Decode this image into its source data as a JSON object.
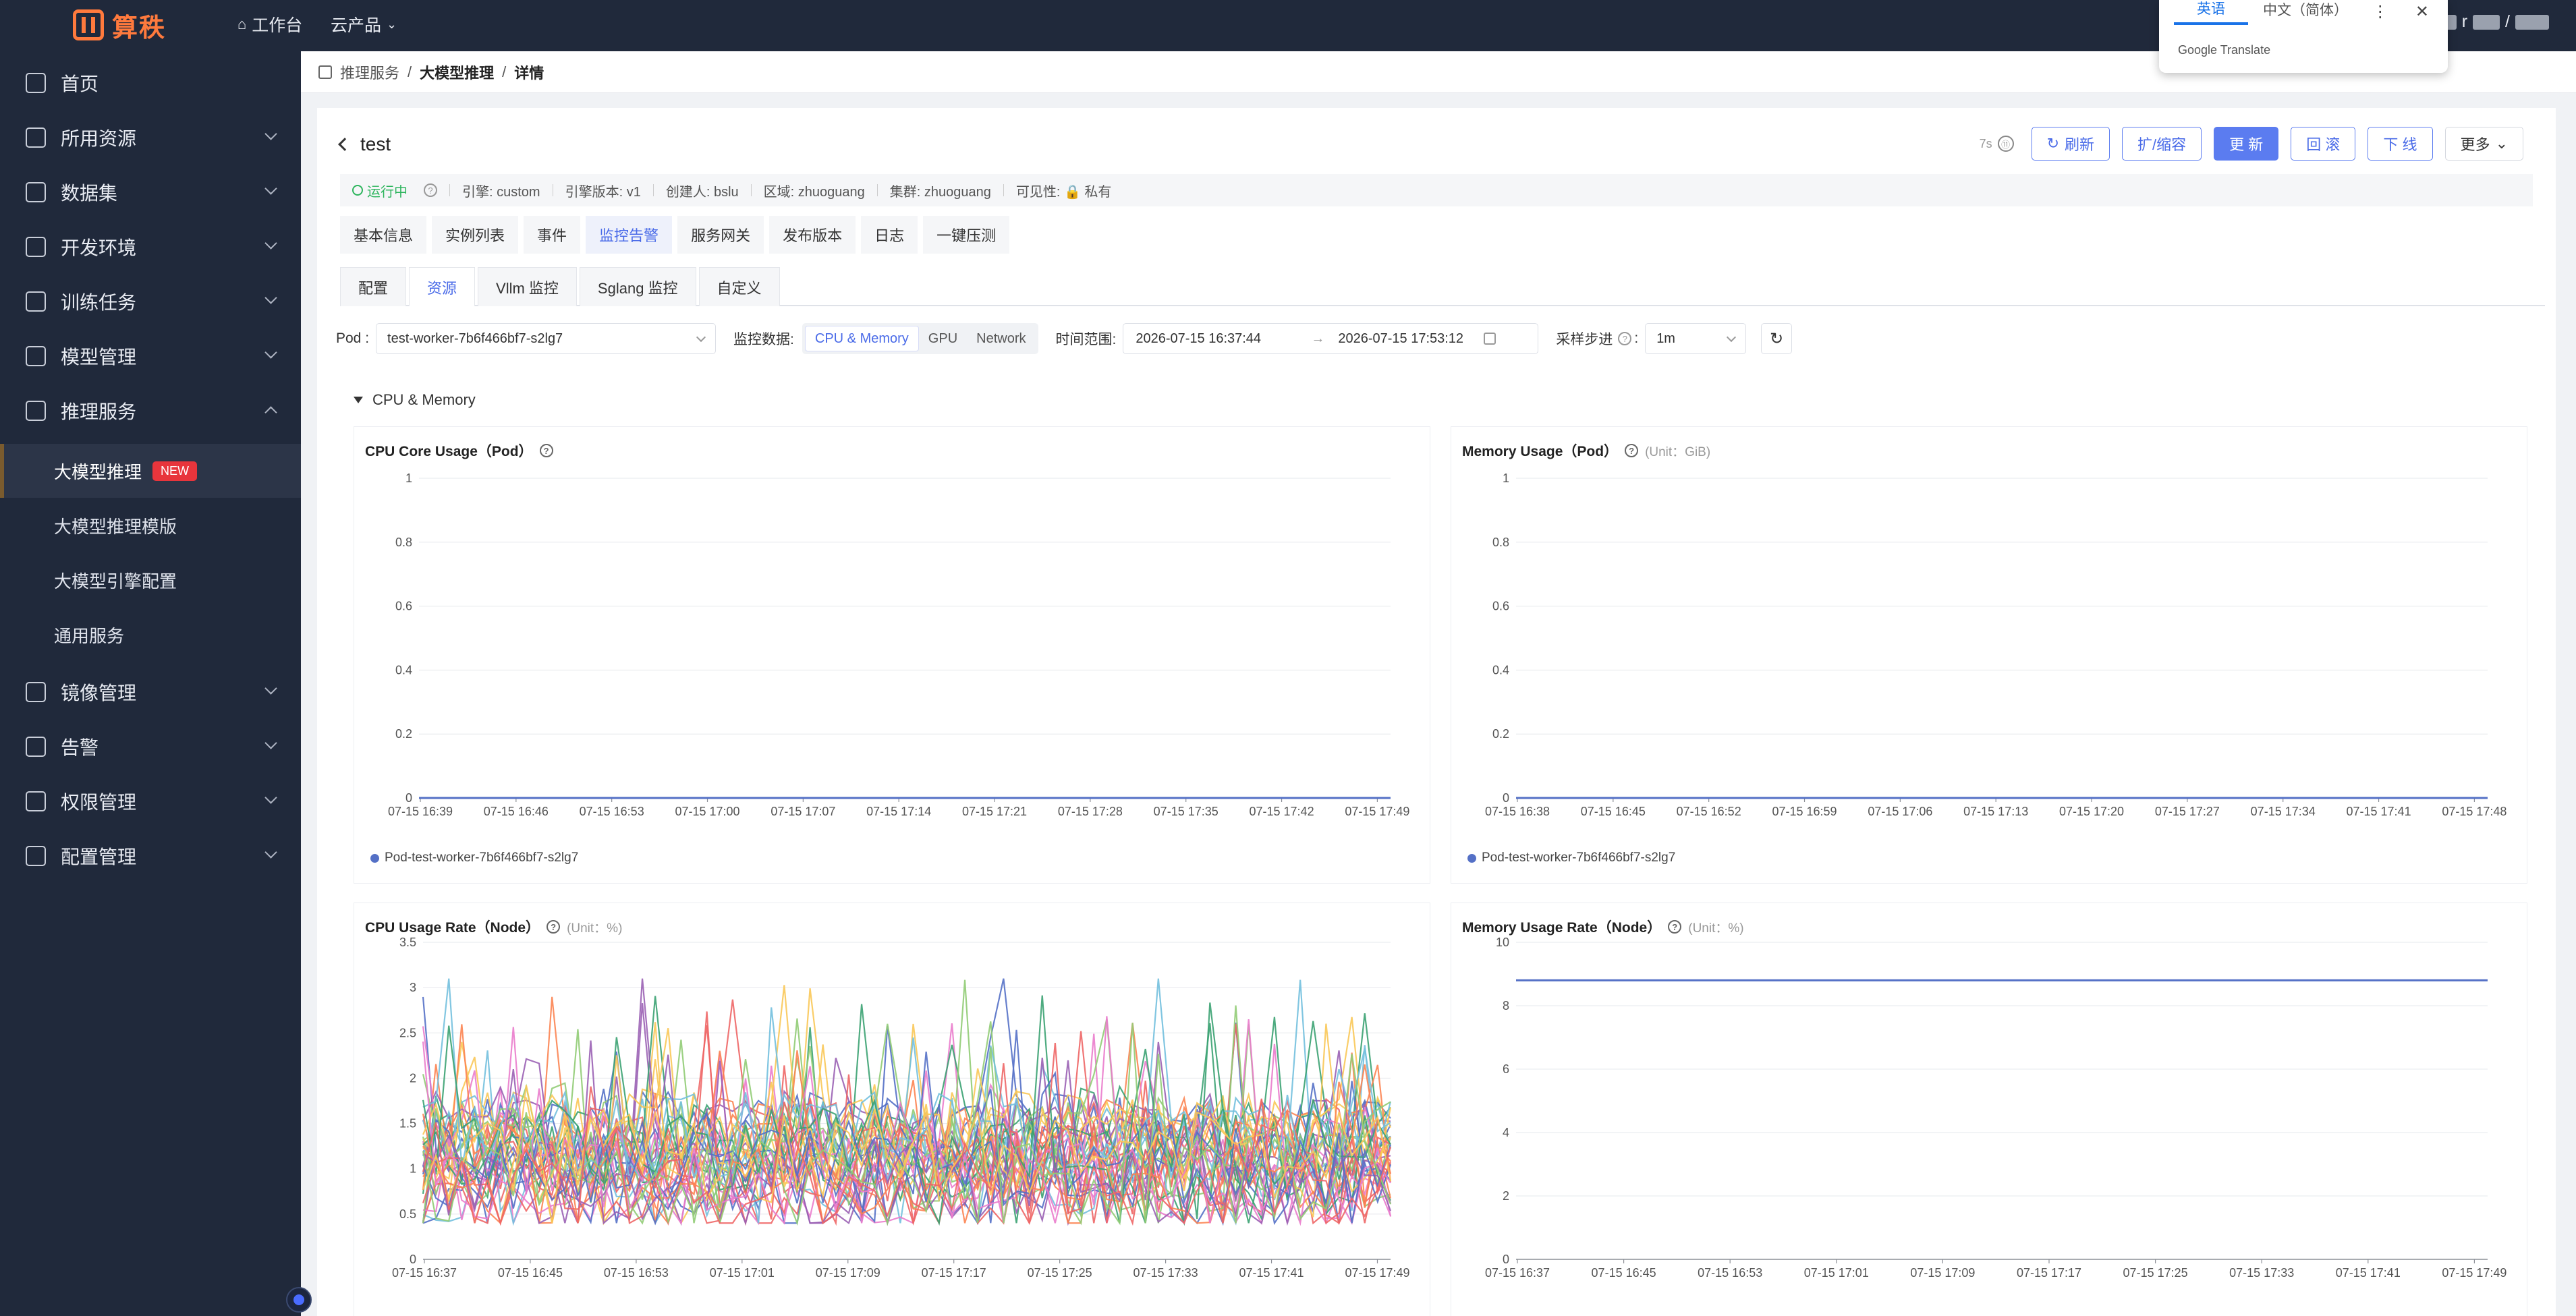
{
  "topbar": {
    "logo_text": "算秩",
    "workbench": "工作台",
    "cloud_products": "云产品",
    "user_sep": "/",
    "user_partial": "r"
  },
  "translate_popup": {
    "tab_en": "英语",
    "tab_zh": "中文（简体）",
    "brand": "Google Translate"
  },
  "sidebar": {
    "items": [
      {
        "label": "首页",
        "icon": "home-icon"
      },
      {
        "label": "所用资源",
        "icon": "resource-icon"
      },
      {
        "label": "数据集",
        "icon": "dataset-icon"
      },
      {
        "label": "开发环境",
        "icon": "dev-env-icon"
      },
      {
        "label": "训练任务",
        "icon": "training-icon"
      },
      {
        "label": "模型管理",
        "icon": "model-icon"
      },
      {
        "label": "推理服务",
        "icon": "inference-icon"
      },
      {
        "label": "镜像管理",
        "icon": "image-icon"
      },
      {
        "label": "告警",
        "icon": "alert-icon"
      },
      {
        "label": "权限管理",
        "icon": "permission-icon"
      },
      {
        "label": "配置管理",
        "icon": "config-icon"
      }
    ],
    "sub_items": [
      {
        "label": "大模型推理",
        "badge": "NEW"
      },
      {
        "label": "大模型推理模版"
      },
      {
        "label": "大模型引擎配置"
      },
      {
        "label": "通用服务"
      }
    ]
  },
  "breadcrumb": {
    "root": "推理服务",
    "mid": "大模型推理",
    "leaf": "详情",
    "sep": "/"
  },
  "page": {
    "title": "test",
    "timer": "7s",
    "timer_icon": "⑪",
    "actions": {
      "refresh": "刷新",
      "scale": "扩/缩容",
      "update": "更 新",
      "rollback": "回 滚",
      "offline": "下 线",
      "more": "更多"
    }
  },
  "meta": {
    "status": "运行中",
    "engine": "引擎: custom",
    "engine_version": "引擎版本: v1",
    "creator": "创建人: bslu",
    "region": "区域: zhuoguang",
    "cluster": "集群: zhuoguang",
    "visibility": "可见性: 🔒 私有"
  },
  "tabs_main": [
    "基本信息",
    "实例列表",
    "事件",
    "监控告警",
    "服务网关",
    "发布版本",
    "日志",
    "一键压测"
  ],
  "tabs_monitor": [
    "配置",
    "资源",
    "Vllm 监控",
    "Sglang 监控",
    "自定义"
  ],
  "filters": {
    "pod_label": "Pod :",
    "pod_value": "test-worker-7b6f466bf7-s2lg7",
    "data_label": "监控数据:",
    "data_options": [
      "CPU & Memory",
      "GPU",
      "Network"
    ],
    "time_label": "时间范围:",
    "time_start": "2026-07-15 16:37:44",
    "time_arrow": "→",
    "time_end": "2026-07-15 17:53:12",
    "step_label": "采样步进",
    "step_help": "?",
    "step_colon": ":",
    "step_value": "1m"
  },
  "section": {
    "title": "CPU & Memory"
  },
  "charts": {
    "cpu_core": {
      "title": "CPU Core Usage（Pod）",
      "unit": "",
      "legend": "Pod-test-worker-7b6f466bf7-s2lg7"
    },
    "mem_usage": {
      "title": "Memory Usage（Pod）",
      "unit": "(Unit：GiB)",
      "legend": "Pod-test-worker-7b6f466bf7-s2lg7"
    },
    "cpu_rate": {
      "title": "CPU Usage Rate（Node）",
      "unit": "(Unit：%)"
    },
    "mem_rate": {
      "title": "Memory Usage Rate（Node）",
      "unit": "(Unit：%)"
    }
  },
  "chart_data": [
    {
      "type": "line",
      "ylim": [
        0,
        1
      ],
      "yticks": [
        "0",
        "0.2",
        "0.4",
        "0.6",
        "0.8",
        "1"
      ],
      "categories": [
        "07-15 16:39",
        "07-15 16:46",
        "07-15 16:53",
        "07-15 17:00",
        "07-15 17:07",
        "07-15 17:14",
        "07-15 17:21",
        "07-15 17:28",
        "07-15 17:35",
        "07-15 17:42",
        "07-15 17:49"
      ],
      "series": [
        {
          "name": "Pod-test-worker-7b6f466bf7-s2lg7",
          "values": [
            0,
            0,
            0,
            0,
            0,
            0,
            0,
            0,
            0,
            0,
            0
          ]
        }
      ],
      "color": "#5470c6"
    },
    {
      "type": "line",
      "ylim": [
        0,
        1
      ],
      "yticks": [
        "0",
        "0.2",
        "0.4",
        "0.6",
        "0.8",
        "1"
      ],
      "categories": [
        "07-15 16:38",
        "07-15 16:45",
        "07-15 16:52",
        "07-15 16:59",
        "07-15 17:06",
        "07-15 17:13",
        "07-15 17:20",
        "07-15 17:27",
        "07-15 17:34",
        "07-15 17:41",
        "07-15 17:48"
      ],
      "series": [
        {
          "name": "Pod-test-worker-7b6f466bf7-s2lg7",
          "values": [
            0,
            0,
            0,
            0,
            0,
            0,
            0,
            0,
            0,
            0,
            0
          ]
        }
      ],
      "color": "#5470c6"
    },
    {
      "type": "line",
      "ylim": [
        0,
        3.5
      ],
      "yticks": [
        "0",
        "0.5",
        "1",
        "1.5",
        "2",
        "2.5",
        "3",
        "3.5"
      ],
      "categories": [
        "07-15 16:37",
        "07-15 16:45",
        "07-15 16:53",
        "07-15 17:01",
        "07-15 17:09",
        "07-15 17:17",
        "07-15 17:25",
        "07-15 17:33",
        "07-15 17:41",
        "07-15 17:49"
      ],
      "many_series_range": [
        0.4,
        3.1
      ],
      "colors": [
        "#5470c6",
        "#91cc75",
        "#fac858",
        "#ee6666",
        "#73c0de",
        "#3ba272",
        "#fc8452",
        "#9a60b4",
        "#ea7ccc"
      ]
    },
    {
      "type": "line",
      "ylim": [
        0,
        10
      ],
      "yticks": [
        "0",
        "2",
        "4",
        "6",
        "8",
        "10"
      ],
      "categories": [
        "07-15 16:37",
        "07-15 16:45",
        "07-15 16:53",
        "07-15 17:01",
        "07-15 17:09",
        "07-15 17:17",
        "07-15 17:25",
        "07-15 17:33",
        "07-15 17:41",
        "07-15 17:49"
      ],
      "series": [
        {
          "values": [
            8.8,
            8.8,
            8.8,
            8.8,
            8.8,
            8.8,
            8.8,
            8.8,
            8.8,
            8.8
          ]
        }
      ],
      "color": "#5470c6"
    }
  ]
}
